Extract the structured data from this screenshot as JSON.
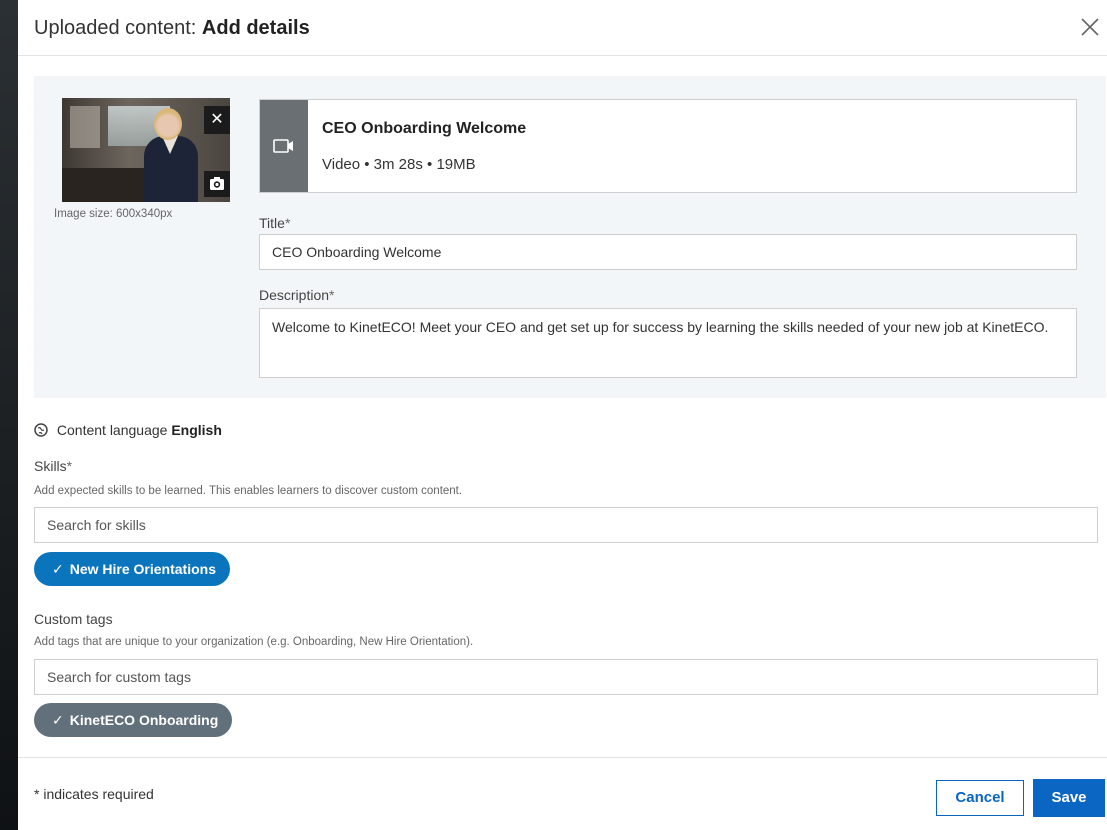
{
  "header": {
    "prefix": "Uploaded content:",
    "title": "Add details"
  },
  "thumbnail": {
    "image_size": "Image size: 600x340px",
    "remove_label": "✕"
  },
  "media": {
    "name": "CEO Onboarding Welcome",
    "meta": "Video • 3m 28s • 19MB"
  },
  "form": {
    "title_label": "Title",
    "title_value": "CEO Onboarding Welcome",
    "description_label": "Description",
    "description_value": "Welcome to KinetECO! Meet your CEO and get set up for success by learning the skills needed of your new job at KinetECO.",
    "required_mark": "*"
  },
  "language": {
    "label": "Content language",
    "value": "English"
  },
  "skills": {
    "label": "Skills",
    "help": "Add expected skills to be learned. This enables learners to discover custom content.",
    "placeholder": "Search for skills",
    "selected": "New Hire Orientations"
  },
  "tags": {
    "label": "Custom tags",
    "help": "Add tags that are unique to your organization (e.g. Onboarding, New Hire Orientation).",
    "placeholder": "Search for custom tags",
    "selected": "KinetECO Onboarding"
  },
  "footer": {
    "note": "* indicates required",
    "cancel": "Cancel",
    "save": "Save"
  },
  "colors": {
    "primary": "#0a66c2",
    "skill_pill": "#0a75bd",
    "tag_pill": "#61707a"
  }
}
